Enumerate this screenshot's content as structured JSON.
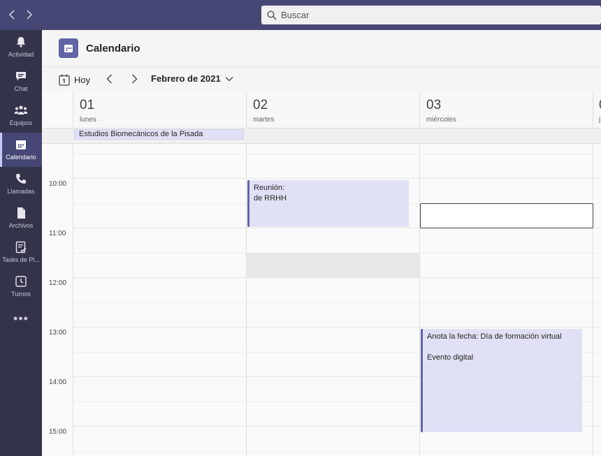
{
  "search": {
    "placeholder": "Buscar"
  },
  "rail": {
    "items": [
      {
        "label": "Actividad",
        "icon": "bell-icon"
      },
      {
        "label": "Chat",
        "icon": "chat-icon"
      },
      {
        "label": "Equipos",
        "icon": "teams-icon"
      },
      {
        "label": "Calendario",
        "icon": "calendar-icon",
        "active": true
      },
      {
        "label": "Llamadas",
        "icon": "phone-icon"
      },
      {
        "label": "Archivos",
        "icon": "file-icon"
      },
      {
        "label": "Tasks de Pl...",
        "icon": "tasks-icon"
      },
      {
        "label": "Turnos",
        "icon": "clock-icon"
      }
    ],
    "more": "•••"
  },
  "header": {
    "title": "Calendario"
  },
  "toolbar": {
    "today_label": "Hoy",
    "month_label": "Febrero de 2021"
  },
  "days": [
    {
      "num": "01",
      "name": "lunes"
    },
    {
      "num": "02",
      "name": "martes"
    },
    {
      "num": "03",
      "name": "miércoles"
    },
    {
      "num": "0",
      "name": "j"
    }
  ],
  "allday_event": {
    "title": "Estudios Biomecánicos de la Pisada"
  },
  "times": [
    "10:00",
    "11:00",
    "12:00",
    "13:00",
    "14:00",
    "15:00"
  ],
  "events": [
    {
      "title_line1": "Reunión:",
      "title_line2": "de RRHH"
    },
    {
      "title": "Anota la fecha: Día de formación virtual",
      "subtitle": "Evento digital"
    }
  ],
  "colors": {
    "accent": "#6264a7",
    "topbar": "#464775",
    "rail": "#33344a",
    "event_bg": "#e1e1f6"
  }
}
